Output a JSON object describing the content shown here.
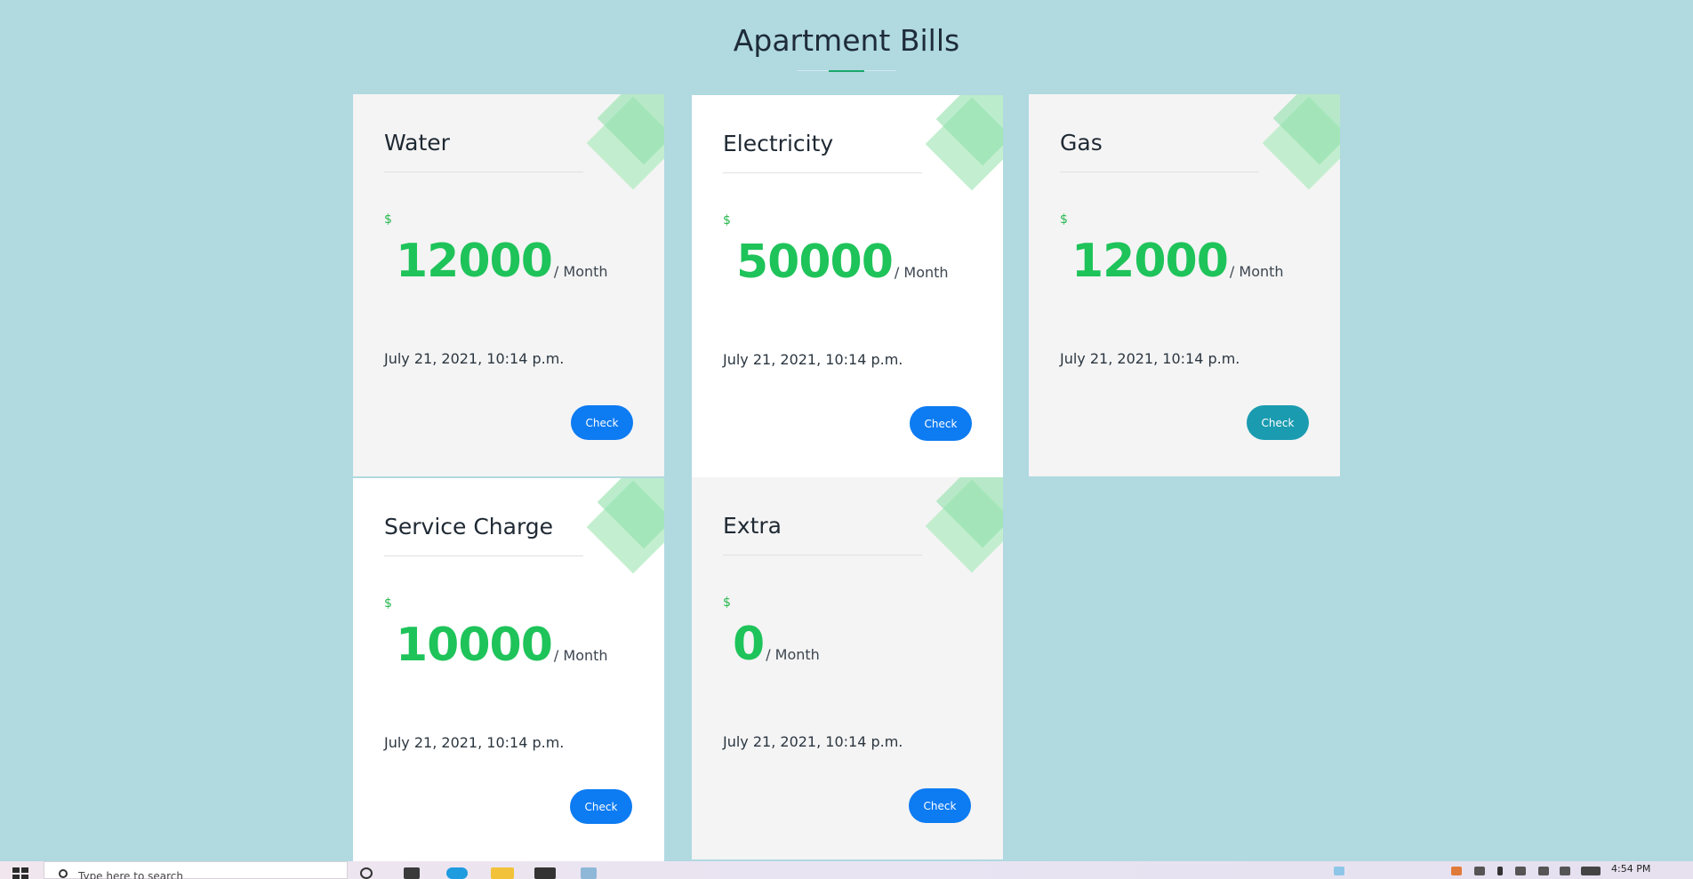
{
  "page": {
    "title": "Apartment Bills"
  },
  "colors": {
    "background": "#b0d9e0",
    "amount_green": "#1ec35a",
    "accent_green": "#1aa86b",
    "button_blue": "#0d7bf2",
    "button_teal": "#1a9bb0"
  },
  "cards": [
    {
      "title": "Water",
      "currency": "$",
      "amount": "12000",
      "period": "/ Month",
      "date": "July 21, 2021, 10:14 p.m.",
      "button": "Check"
    },
    {
      "title": "Electricity",
      "currency": "$",
      "amount": "50000",
      "period": "/ Month",
      "date": "July 21, 2021, 10:14 p.m.",
      "button": "Check"
    },
    {
      "title": "Gas",
      "currency": "$",
      "amount": "12000",
      "period": "/ Month",
      "date": "July 21, 2021, 10:14 p.m.",
      "button": "Check"
    },
    {
      "title": "Service Charge",
      "currency": "$",
      "amount": "10000",
      "period": "/ Month",
      "date": "July 21, 2021, 10:14 p.m.",
      "button": "Check"
    },
    {
      "title": "Extra",
      "currency": "$",
      "amount": "0",
      "period": "/ Month",
      "date": "July 21, 2021, 10:14 p.m.",
      "button": "Check"
    }
  ],
  "taskbar": {
    "search_placeholder": "Type here to search",
    "clock": "4:54 PM",
    "icons": [
      "windows-start-icon",
      "search-icon",
      "task-view-icon",
      "edge-browser-icon",
      "file-explorer-icon",
      "briefcase-icon",
      "app-icon"
    ]
  }
}
